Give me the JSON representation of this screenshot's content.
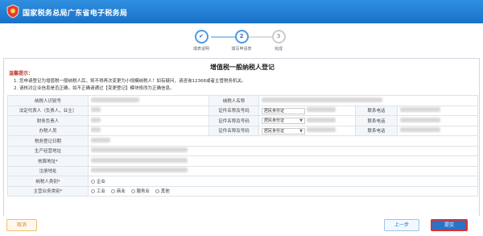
{
  "header": {
    "title": "国家税务总局广东省电子税务局"
  },
  "steps": [
    {
      "num": "✔",
      "label": "填表说明",
      "state": "done"
    },
    {
      "num": "2",
      "label": "填写申请表",
      "state": "active"
    },
    {
      "num": "3",
      "label": "完成",
      "state": "todo"
    }
  ],
  "form": {
    "title": "增值税一般纳税人登记",
    "tips": {
      "title": "温馨提示：",
      "lines": [
        "1. 您申请登记为增值税一般纳税人后，将不得再次变更为小规模纳税人！如有疑问，请咨询12366或者主管税务机关。",
        "2. 请核对企业信息是否正确，如不正确请通过【变更登记】模块修改为正确信息。"
      ]
    },
    "labels": {
      "taxpayer_id": "纳税人识别号",
      "taxpayer_name": "纳税人名称",
      "legal_rep": "法定代表人（负责人，业主）",
      "finance_head": "财务负责人",
      "tax_agent": "办税人员",
      "tax_reg_date": "税务登记日期",
      "business_address": "生产经营地址",
      "accounting_address": "核算地址*",
      "registered_address": "注册地址",
      "taxpayer_category": "纳税人类别*",
      "main_business_category": "主营业务类别*",
      "id_type_no": "证件名称及号码",
      "phone": "联系电话"
    },
    "id_type_selected": "居民身份证",
    "taxpayer_category_options": [
      "企业"
    ],
    "business_category_options": [
      "工业",
      "商业",
      "服务业",
      "其他"
    ]
  },
  "footer": {
    "cancel": "取消",
    "prev": "上一步",
    "submit": "提交"
  },
  "colors": {
    "header_bg": "#1a72c8",
    "accent": "#2a72c8",
    "tip_red": "#c0392b",
    "submit_border": "#e03030"
  }
}
